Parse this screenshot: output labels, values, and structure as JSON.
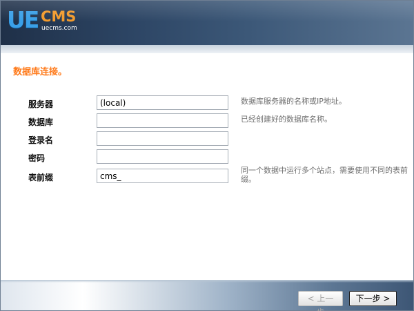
{
  "brand": {
    "logo_primary": "UE",
    "logo_secondary": "CMS",
    "logo_domain": "uecms.com"
  },
  "section": {
    "title": "数据库连接。"
  },
  "form": {
    "fields": [
      {
        "label": "服务器",
        "value": "(local)",
        "hint": "数据库服务器的名称或IP地址。"
      },
      {
        "label": "数据库",
        "value": "",
        "hint": "已经创建好的数据库名称。"
      },
      {
        "label": "登录名",
        "value": "",
        "hint": ""
      },
      {
        "label": "密码",
        "value": "",
        "hint": ""
      },
      {
        "label": "表前缀",
        "value": "cms_",
        "hint": "同一个数据中运行多个站点，需要使用不同的表前缀。"
      }
    ]
  },
  "navigation": {
    "prev_label": "< 上一步",
    "next_label": "下一步 >"
  },
  "colors": {
    "header_dark": "#1f3048",
    "accent_orange": "#ff7a1a",
    "logo_blue": "#3aa0e8",
    "logo_orange": "#f29a2b"
  }
}
